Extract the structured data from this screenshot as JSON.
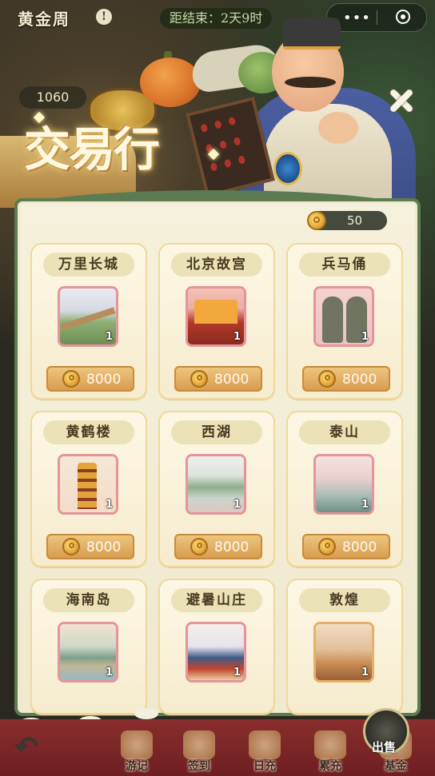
{
  "header": {
    "app_title": "黄金周",
    "alert_icon": "!",
    "countdown": "距结束：2天9时",
    "coin_count": "1060"
  },
  "capsule": {
    "more_icon": "•••",
    "close_icon": "target-icon"
  },
  "banner": {
    "title": "交易行"
  },
  "panel": {
    "balance": "50",
    "cards": [
      {
        "name": "万里长城",
        "qty": "1",
        "price": "8000",
        "art": "great-wall"
      },
      {
        "name": "北京故宫",
        "qty": "1",
        "price": "8000",
        "art": "forbidden-city"
      },
      {
        "name": "兵马俑",
        "qty": "1",
        "price": "8000",
        "art": "terracotta-warriors"
      },
      {
        "name": "黄鹤楼",
        "qty": "1",
        "price": "8000",
        "art": "yellow-crane-tower"
      },
      {
        "name": "西湖",
        "qty": "1",
        "price": "8000",
        "art": "west-lake"
      },
      {
        "name": "泰山",
        "qty": "1",
        "price": "8000",
        "art": "mount-tai"
      },
      {
        "name": "海南岛",
        "qty": "1",
        "price": "",
        "art": "hainan-island"
      },
      {
        "name": "避暑山庄",
        "qty": "1",
        "price": "",
        "art": "summer-resort"
      },
      {
        "name": "敦煌",
        "qty": "1",
        "price": "",
        "art": "dunhuang"
      }
    ]
  },
  "sell": {
    "label": "出售"
  },
  "bottom_nav": {
    "items": [
      {
        "label": "游记"
      },
      {
        "label": "签到"
      },
      {
        "label": "日充"
      },
      {
        "label": "累充"
      },
      {
        "label": "基金"
      }
    ]
  },
  "colors": {
    "panel_border": "#5c7b52",
    "price_button": "#d79d4e",
    "nav_bar": "#7a2528"
  }
}
